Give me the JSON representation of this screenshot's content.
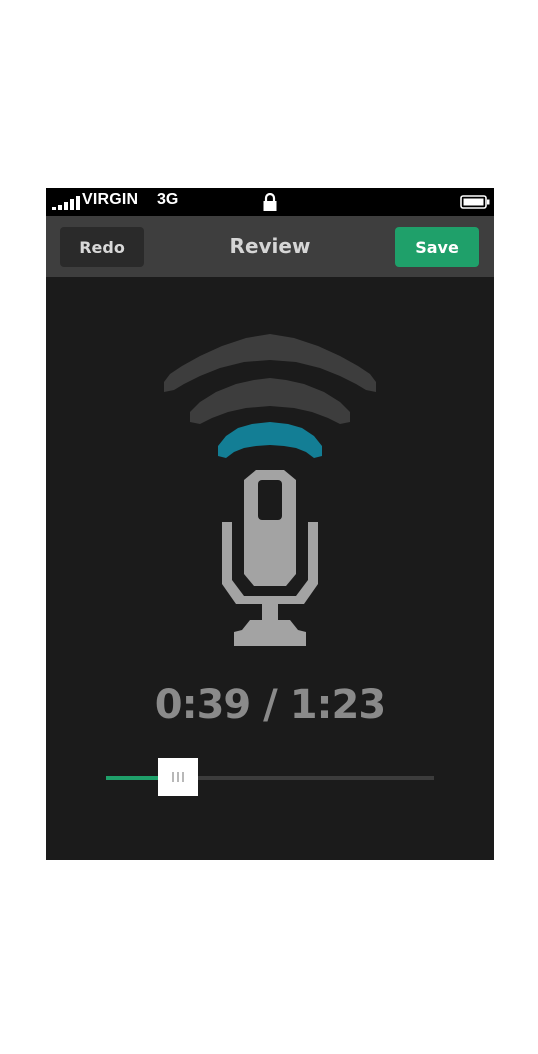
{
  "status_bar": {
    "carrier": "VIRGIN",
    "network": "3G",
    "signal_icon": "signal-bars-icon",
    "lock_icon": "lock-icon",
    "battery_icon": "battery-icon"
  },
  "nav": {
    "title": "Review",
    "left_button": "Redo",
    "right_button": "Save"
  },
  "player": {
    "illustration": "microphone-broadcast-icon",
    "elapsed": "0:39",
    "total": "1:23",
    "time_display": "0:39 / 1:23",
    "progress": 0.22
  },
  "colors": {
    "accent_green": "#1fa06a",
    "wave_blue": "#137e95",
    "wave_gray": "#3d3d3d",
    "mic_gray": "#a3a3a3",
    "background": "#1b1b1b",
    "nav_bar": "#3e3e3e"
  }
}
